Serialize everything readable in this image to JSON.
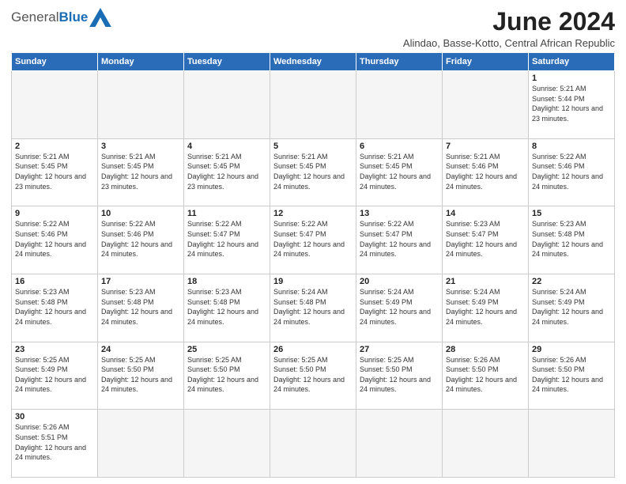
{
  "logo": {
    "text_general": "General",
    "text_blue": "Blue"
  },
  "header": {
    "month_year": "June 2024",
    "location": "Alindao, Basse-Kotto, Central African Republic"
  },
  "weekdays": [
    "Sunday",
    "Monday",
    "Tuesday",
    "Wednesday",
    "Thursday",
    "Friday",
    "Saturday"
  ],
  "weeks": [
    [
      {
        "day": "",
        "info": ""
      },
      {
        "day": "",
        "info": ""
      },
      {
        "day": "",
        "info": ""
      },
      {
        "day": "",
        "info": ""
      },
      {
        "day": "",
        "info": ""
      },
      {
        "day": "",
        "info": ""
      },
      {
        "day": "1",
        "info": "Sunrise: 5:21 AM\nSunset: 5:44 PM\nDaylight: 12 hours and 23 minutes."
      }
    ],
    [
      {
        "day": "2",
        "info": "Sunrise: 5:21 AM\nSunset: 5:45 PM\nDaylight: 12 hours and 23 minutes."
      },
      {
        "day": "3",
        "info": "Sunrise: 5:21 AM\nSunset: 5:45 PM\nDaylight: 12 hours and 23 minutes."
      },
      {
        "day": "4",
        "info": "Sunrise: 5:21 AM\nSunset: 5:45 PM\nDaylight: 12 hours and 23 minutes."
      },
      {
        "day": "5",
        "info": "Sunrise: 5:21 AM\nSunset: 5:45 PM\nDaylight: 12 hours and 24 minutes."
      },
      {
        "day": "6",
        "info": "Sunrise: 5:21 AM\nSunset: 5:45 PM\nDaylight: 12 hours and 24 minutes."
      },
      {
        "day": "7",
        "info": "Sunrise: 5:21 AM\nSunset: 5:46 PM\nDaylight: 12 hours and 24 minutes."
      },
      {
        "day": "8",
        "info": "Sunrise: 5:22 AM\nSunset: 5:46 PM\nDaylight: 12 hours and 24 minutes."
      }
    ],
    [
      {
        "day": "9",
        "info": "Sunrise: 5:22 AM\nSunset: 5:46 PM\nDaylight: 12 hours and 24 minutes."
      },
      {
        "day": "10",
        "info": "Sunrise: 5:22 AM\nSunset: 5:46 PM\nDaylight: 12 hours and 24 minutes."
      },
      {
        "day": "11",
        "info": "Sunrise: 5:22 AM\nSunset: 5:47 PM\nDaylight: 12 hours and 24 minutes."
      },
      {
        "day": "12",
        "info": "Sunrise: 5:22 AM\nSunset: 5:47 PM\nDaylight: 12 hours and 24 minutes."
      },
      {
        "day": "13",
        "info": "Sunrise: 5:22 AM\nSunset: 5:47 PM\nDaylight: 12 hours and 24 minutes."
      },
      {
        "day": "14",
        "info": "Sunrise: 5:23 AM\nSunset: 5:47 PM\nDaylight: 12 hours and 24 minutes."
      },
      {
        "day": "15",
        "info": "Sunrise: 5:23 AM\nSunset: 5:48 PM\nDaylight: 12 hours and 24 minutes."
      }
    ],
    [
      {
        "day": "16",
        "info": "Sunrise: 5:23 AM\nSunset: 5:48 PM\nDaylight: 12 hours and 24 minutes."
      },
      {
        "day": "17",
        "info": "Sunrise: 5:23 AM\nSunset: 5:48 PM\nDaylight: 12 hours and 24 minutes."
      },
      {
        "day": "18",
        "info": "Sunrise: 5:23 AM\nSunset: 5:48 PM\nDaylight: 12 hours and 24 minutes."
      },
      {
        "day": "19",
        "info": "Sunrise: 5:24 AM\nSunset: 5:48 PM\nDaylight: 12 hours and 24 minutes."
      },
      {
        "day": "20",
        "info": "Sunrise: 5:24 AM\nSunset: 5:49 PM\nDaylight: 12 hours and 24 minutes."
      },
      {
        "day": "21",
        "info": "Sunrise: 5:24 AM\nSunset: 5:49 PM\nDaylight: 12 hours and 24 minutes."
      },
      {
        "day": "22",
        "info": "Sunrise: 5:24 AM\nSunset: 5:49 PM\nDaylight: 12 hours and 24 minutes."
      }
    ],
    [
      {
        "day": "23",
        "info": "Sunrise: 5:25 AM\nSunset: 5:49 PM\nDaylight: 12 hours and 24 minutes."
      },
      {
        "day": "24",
        "info": "Sunrise: 5:25 AM\nSunset: 5:50 PM\nDaylight: 12 hours and 24 minutes."
      },
      {
        "day": "25",
        "info": "Sunrise: 5:25 AM\nSunset: 5:50 PM\nDaylight: 12 hours and 24 minutes."
      },
      {
        "day": "26",
        "info": "Sunrise: 5:25 AM\nSunset: 5:50 PM\nDaylight: 12 hours and 24 minutes."
      },
      {
        "day": "27",
        "info": "Sunrise: 5:25 AM\nSunset: 5:50 PM\nDaylight: 12 hours and 24 minutes."
      },
      {
        "day": "28",
        "info": "Sunrise: 5:26 AM\nSunset: 5:50 PM\nDaylight: 12 hours and 24 minutes."
      },
      {
        "day": "29",
        "info": "Sunrise: 5:26 AM\nSunset: 5:50 PM\nDaylight: 12 hours and 24 minutes."
      }
    ],
    [
      {
        "day": "30",
        "info": "Sunrise: 5:26 AM\nSunset: 5:51 PM\nDaylight: 12 hours and 24 minutes."
      },
      {
        "day": "",
        "info": ""
      },
      {
        "day": "",
        "info": ""
      },
      {
        "day": "",
        "info": ""
      },
      {
        "day": "",
        "info": ""
      },
      {
        "day": "",
        "info": ""
      },
      {
        "day": "",
        "info": ""
      }
    ]
  ]
}
